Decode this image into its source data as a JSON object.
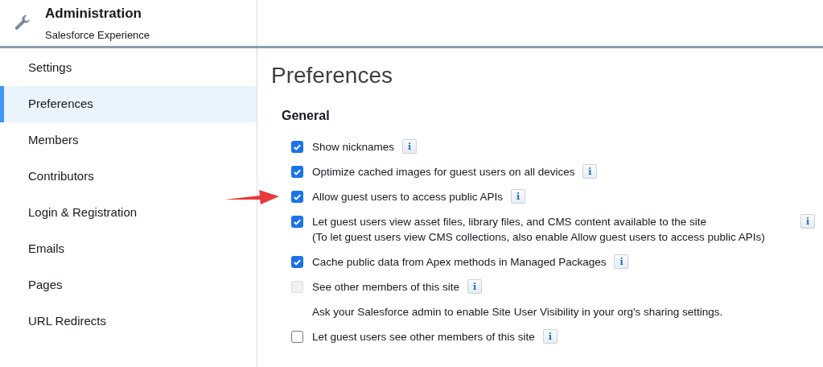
{
  "header": {
    "title": "Administration",
    "subtitle": "Salesforce Experience"
  },
  "sidebar": {
    "items": [
      {
        "label": "Settings",
        "selected": false
      },
      {
        "label": "Preferences",
        "selected": true
      },
      {
        "label": "Members",
        "selected": false
      },
      {
        "label": "Contributors",
        "selected": false
      },
      {
        "label": "Login & Registration",
        "selected": false
      },
      {
        "label": "Emails",
        "selected": false
      },
      {
        "label": "Pages",
        "selected": false
      },
      {
        "label": "URL Redirects",
        "selected": false
      }
    ]
  },
  "page": {
    "title": "Preferences",
    "section": "General",
    "options": [
      {
        "kind": "checkbox",
        "label": "Show nicknames",
        "checked": true,
        "disabled": false,
        "info": "i"
      },
      {
        "kind": "checkbox",
        "label": "Optimize cached images for guest users on all devices",
        "checked": true,
        "disabled": false,
        "info": "i"
      },
      {
        "kind": "checkbox",
        "label": "Allow guest users to access public APIs",
        "checked": true,
        "disabled": false,
        "info": "i",
        "highlighted": true
      },
      {
        "kind": "checkbox",
        "label": "Let guest users view asset files, library files, and CMS content available to the site",
        "sublabel": "(To let guest users view CMS collections, also enable Allow guest users to access public APIs)",
        "checked": true,
        "disabled": false,
        "info": "i"
      },
      {
        "kind": "checkbox",
        "label": "Cache public data from Apex methods in Managed Packages",
        "checked": true,
        "disabled": false,
        "info": "i"
      },
      {
        "kind": "checkbox",
        "label": "See other members of this site",
        "checked": false,
        "disabled": true,
        "info": "i"
      },
      {
        "kind": "note",
        "label": "Ask your Salesforce admin to enable Site User Visibility in your org's sharing settings."
      },
      {
        "kind": "checkbox",
        "label": "Let guest users see other members of this site",
        "checked": false,
        "disabled": false,
        "info": "i"
      }
    ]
  }
}
